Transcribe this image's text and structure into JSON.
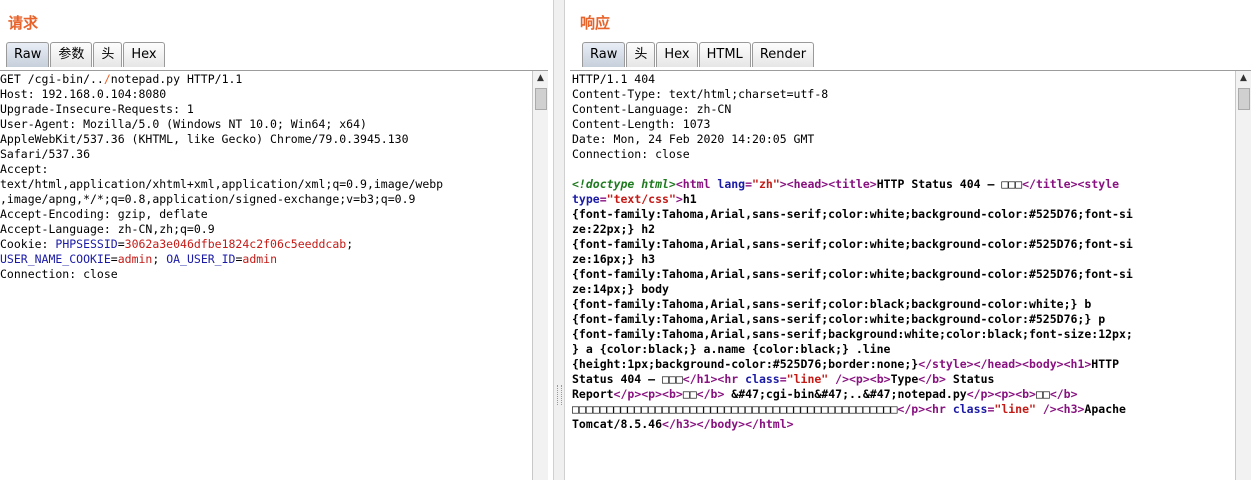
{
  "request": {
    "title": "请求",
    "tabs": [
      "Raw",
      "参数",
      "头",
      "Hex"
    ],
    "lines": {
      "l1a": "GET /cgi-bin/..",
      "l1b": "/",
      "l1c": "notepad.py HTTP/1.1",
      "l2": "Host: 192.168.0.104:8080",
      "l3": "Upgrade-Insecure-Requests: 1",
      "l4": "User-Agent: Mozilla/5.0 (Windows NT 10.0; Win64; x64)",
      "l5": "AppleWebKit/537.36 (KHTML, like Gecko) Chrome/79.0.3945.130",
      "l6": "Safari/537.36",
      "l7": "Accept:",
      "l8": "text/html,application/xhtml+xml,application/xml;q=0.9,image/webp",
      "l9": ",image/apng,*/*;q=0.8,application/signed-exchange;v=b3;q=0.9",
      "l10": "Accept-Encoding: gzip, deflate",
      "l11": "Accept-Language: zh-CN,zh;q=0.9",
      "c1": "Cookie: ",
      "c2": "PHPSESSID",
      "c3": "=",
      "c4": "3062a3e046dfbe1824c2f06c5eeddcab",
      "c5": ";",
      "c6": "USER_NAME_COOKIE",
      "c7": "=",
      "c8": "admin",
      "c9": "; ",
      "c10": "OA_USER_ID",
      "c11": "=",
      "c12": "admin",
      "l13": "Connection: close"
    }
  },
  "response": {
    "title": "响应",
    "tabs": [
      "Raw",
      "头",
      "Hex",
      "HTML",
      "Render"
    ],
    "headers": {
      "h1": "HTTP/1.1 404",
      "h2": "Content-Type: text/html;charset=utf-8",
      "h3": "Content-Language: zh-CN",
      "h4": "Content-Length: 1073",
      "h5": "Date: Mon, 24 Feb 2020 14:20:05 GMT",
      "h6": "Connection: close"
    },
    "body": {
      "doctype": "<!doctype html>",
      "html_open": "<html ",
      "lang_attr": "lang",
      "eq": "=",
      "lang_val": "\"zh\"",
      "gt": ">",
      "head_open": "<head>",
      "title_open": "<title>",
      "title_text": "HTTP Status 404 – □□□",
      "title_close": "</title>",
      "style_open": "<style",
      "type_attr": "type",
      "type_val": "\"text/css\"",
      "css_l1": "h1",
      "css_l2": "{font-family:Tahoma,Arial,sans-serif;color:white;background-color:#525D76;font-si",
      "css_l3": "ze:22px;} h2",
      "css_l4": "{font-family:Tahoma,Arial,sans-serif;color:white;background-color:#525D76;font-si",
      "css_l5": "ze:16px;} h3",
      "css_l6": "{font-family:Tahoma,Arial,sans-serif;color:white;background-color:#525D76;font-si",
      "css_l7": "ze:14px;} body",
      "css_l8": "{font-family:Tahoma,Arial,sans-serif;color:black;background-color:white;} b",
      "css_l9": "{font-family:Tahoma,Arial,sans-serif;color:white;background-color:#525D76;} p",
      "css_l10": "{font-family:Tahoma,Arial,sans-serif;background:white;color:black;font-size:12px;",
      "css_l11": "} a {color:black;} a.name {color:black;} .line",
      "css_l12": "{height:1px;background-color:#525D76;border:none;}",
      "style_close": "</style>",
      "head_close": "</head>",
      "body_open": "<body>",
      "h1_open": "<h1>",
      "h1_text_a": "HTTP",
      "h1_text_b": "Status 404 – □□□",
      "h1_close": "</h1>",
      "hr_open": "<hr ",
      "class_attr": "class",
      "class_val": "\"line\"",
      "hr_close": " />",
      "p_open": "<p>",
      "b_open": "<b>",
      "b_type": "Type",
      "b_close": "</b>",
      "status_text": " Status",
      "report": "Report",
      "p_close": "</p>",
      "b_msg": "□□",
      "msg_text": " &#47;cgi-bin&#47;..&#47;notepad.py",
      "desc_text": "□□□□□□□□□□□□□□□□□□□□□□□□□□□□□□□□□□□□□□□□□□□□□□□",
      "h3_open": "<h3>",
      "h3_text_a": "Apache",
      "h3_text_b": "Tomcat/8.5.46",
      "h3_close": "</h3>",
      "body_close": "</body>",
      "html_close": "</html>"
    }
  }
}
